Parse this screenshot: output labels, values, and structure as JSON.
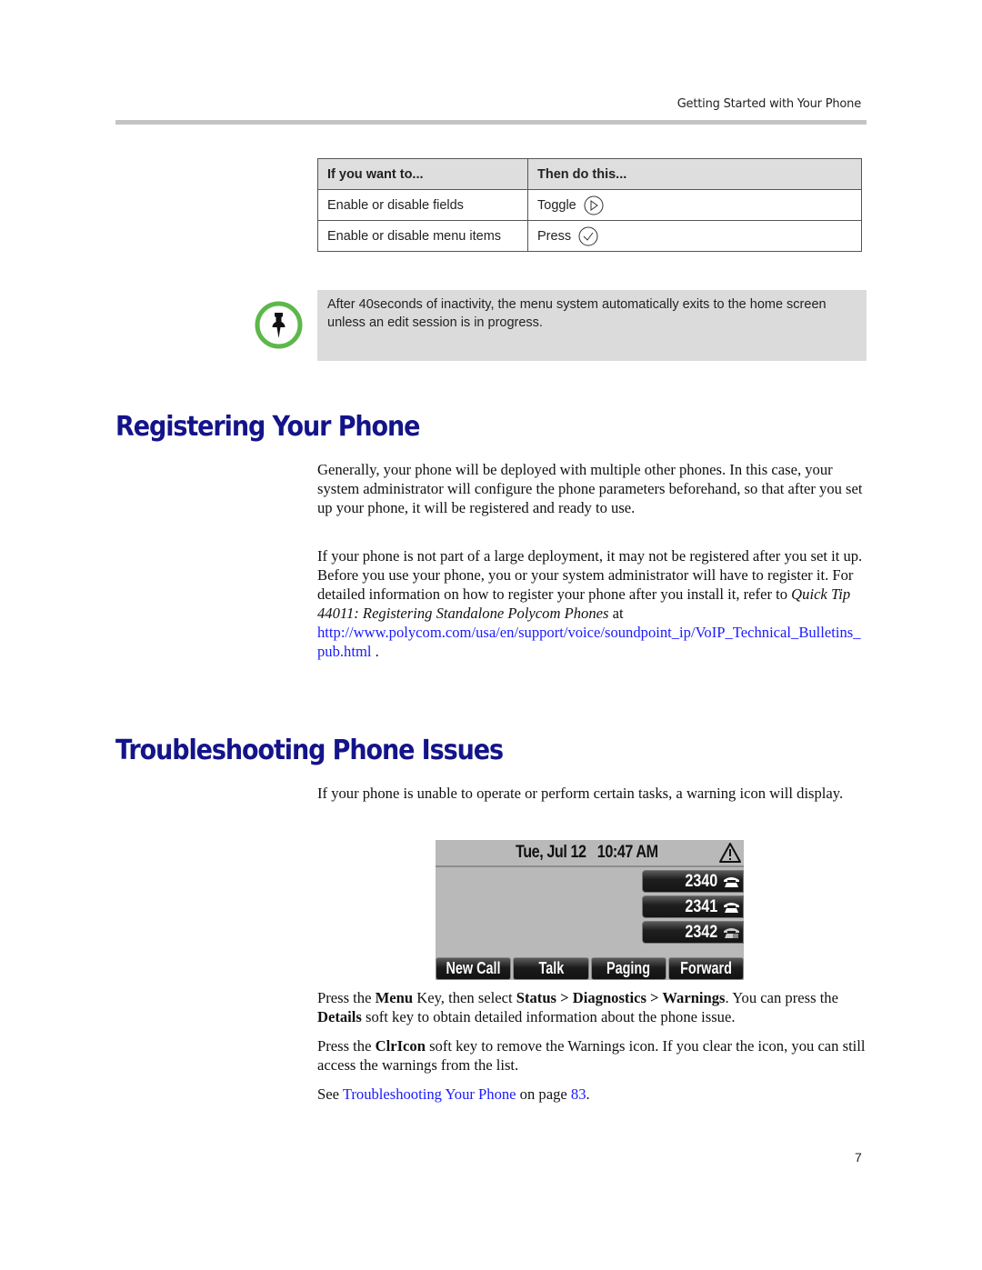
{
  "header": {
    "running_title": "Getting Started with Your Phone"
  },
  "table": {
    "headers": [
      "If you want to...",
      "Then do this..."
    ],
    "rows": [
      {
        "action": "Enable or disable fields",
        "instruction": "Toggle",
        "icon": "right-arrow-key-icon"
      },
      {
        "action": "Enable or disable menu items",
        "instruction": "Press",
        "icon": "select-checkmark-key-icon"
      }
    ]
  },
  "note": {
    "icon": "pushpin-note-icon",
    "text": "After 40seconds of inactivity, the menu system automatically exits to the home screen unless an edit session is in progress.",
    "accent_color": "#5cb84a"
  },
  "sections": {
    "registering": {
      "title": "Registering Your Phone",
      "p1": "Generally, your phone will be deployed with multiple other phones. In this case, your system administrator will configure the phone parameters beforehand, so that after you set up your phone, it will be registered and ready to use.",
      "p2_intro": "If your phone is not part of a large deployment, it may not be registered after you set it up. Before you use your phone, you or your system administrator will have to register it. For detailed information on how to register your phone after you install it, refer to ",
      "p2_citation": "Quick Tip 44011: Registering Standalone Polycom Phones",
      "p2_at": " at",
      "p2_url": "http://www.polycom.com/usa/en/support/voice/soundpoint_ip/VoIP_Technical_Bulletins_pub.html",
      "p2_end": " ."
    },
    "troubleshooting": {
      "title": "Troubleshooting Phone Issues",
      "p1": "If your phone is unable to operate or perform certain tasks, a warning icon will display.",
      "p2": {
        "a": "Press the ",
        "menu": "Menu",
        "b": " Key, then select ",
        "path": "Status > Diagnostics > Warnings",
        "c": ". You can press the ",
        "details": "Details",
        "d": " soft key to obtain detailed information about the phone issue."
      },
      "p3": {
        "a": "Press the ",
        "clricon": "ClrIcon",
        "b": " soft key to remove the Warnings icon. If you clear the icon, you can still access the warnings from the list."
      },
      "p4": {
        "a": "See ",
        "link": "Troubleshooting Your Phone",
        "b": " on page ",
        "page": "83",
        "c": "."
      }
    }
  },
  "phone_screen": {
    "date_time": "Tue, Jul 12   10:47 AM",
    "status_icon": "warning-triangle-icon",
    "lines": [
      "2340",
      "2341",
      "2342"
    ],
    "softkeys": [
      "New Call",
      "Talk",
      "Paging",
      "Forward"
    ]
  },
  "footer": {
    "page_number": "7"
  },
  "colors": {
    "heading": "#14148a",
    "link": "#1a1aff",
    "note_background": "#dbdbdb",
    "rule": "#c4c4c4"
  }
}
